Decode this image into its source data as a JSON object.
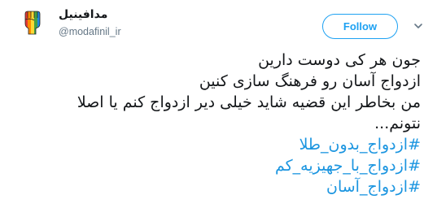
{
  "author": {
    "display_name": "مدافینیل",
    "handle": "@modafinil_ir"
  },
  "header": {
    "follow_label": "Follow"
  },
  "tweet": {
    "lines": [
      "جون هر کی دوست دارین",
      "ازدواج آسان رو فرهنگ سازی کنین",
      "من بخاطر این قضیه شاید خیلی دیر ازدواج کنم یا اصلا",
      "نتونم..."
    ],
    "hashtags": [
      "#ازدواج_بدون_طلا",
      "#ازدواج_با_جهیزیه_کم",
      "#ازدواج_آسان"
    ]
  },
  "colors": {
    "accent": "#1da1f2",
    "hashtag": "#1b95e0",
    "muted": "#657786",
    "text": "#14171a"
  },
  "icons": {
    "avatar": "raised-fist-avatar",
    "menu": "chevron-down-icon"
  }
}
